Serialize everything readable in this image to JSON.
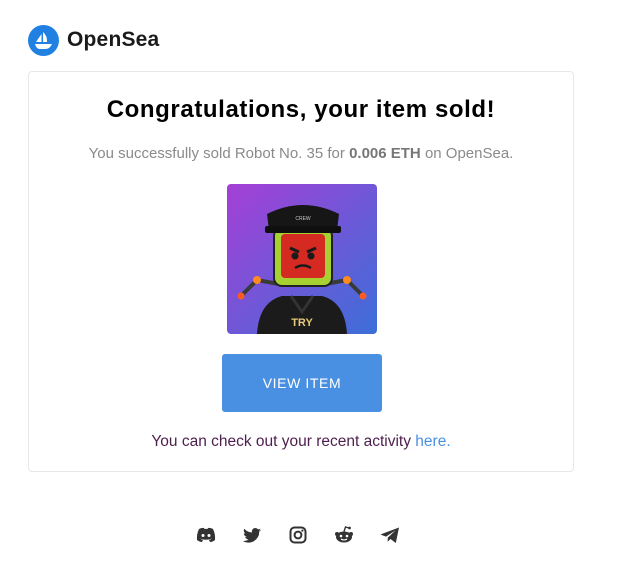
{
  "brand": {
    "name": "OpenSea",
    "accent": "#2081e2",
    "logo_icon": "opensea-logo-icon"
  },
  "email": {
    "title": "Congratulations, your item sold!",
    "subtitle": {
      "prefix": "You successfully sold Robot No. 35 for ",
      "price": "0.006 ETH",
      "suffix": " on OpenSea."
    },
    "item_image": {
      "alt": "Robot No. 35",
      "icon": "robot-nft-image"
    },
    "cta_label": "VIEW ITEM",
    "cta_color": "#4a90e2",
    "activity": {
      "text": "You can check out your recent activity ",
      "link": "here."
    }
  },
  "footer": {
    "socials": [
      {
        "name": "discord",
        "icon": "discord-icon"
      },
      {
        "name": "twitter",
        "icon": "twitter-icon"
      },
      {
        "name": "instagram",
        "icon": "instagram-icon"
      },
      {
        "name": "reddit",
        "icon": "reddit-icon"
      },
      {
        "name": "telegram",
        "icon": "telegram-icon"
      }
    ]
  }
}
